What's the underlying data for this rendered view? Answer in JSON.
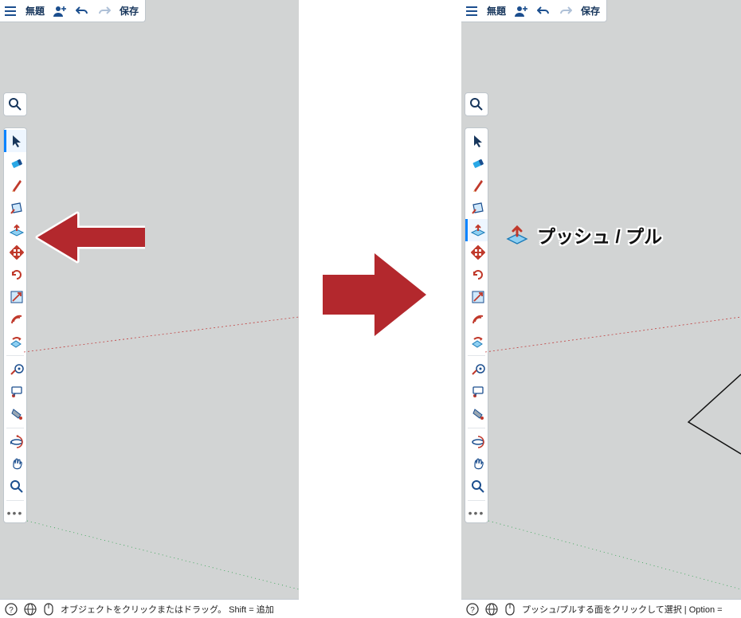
{
  "colors": {
    "accent": "#0a84ff",
    "toolBlue": "#1b4e8e",
    "toolRed": "#c0392b",
    "toolSky": "#2aa8e6",
    "bg": "#d2d4d4"
  },
  "topbar": {
    "title": "無題",
    "save": "保存"
  },
  "tools": {
    "select": "選択",
    "eraser": "消しゴム",
    "pencil": "線",
    "rectangle": "長方形",
    "pushpull": "プッシュ/プル",
    "move": "移動",
    "rotate": "回転",
    "scale": "尺度",
    "offset": "オフセット",
    "followme": "フォローミー",
    "tape": "メジャー",
    "text": "テキスト",
    "paint": "ペイント",
    "orbit": "オービット",
    "pan": "パン",
    "zoom": "ズーム"
  },
  "tooltip": {
    "label": "プッシュ / プル"
  },
  "status": {
    "left": "オブジェクトをクリックまたはドラッグ。 Shift = 追加",
    "right": "プッシュ/プルする面をクリックして選択 | Option = "
  }
}
